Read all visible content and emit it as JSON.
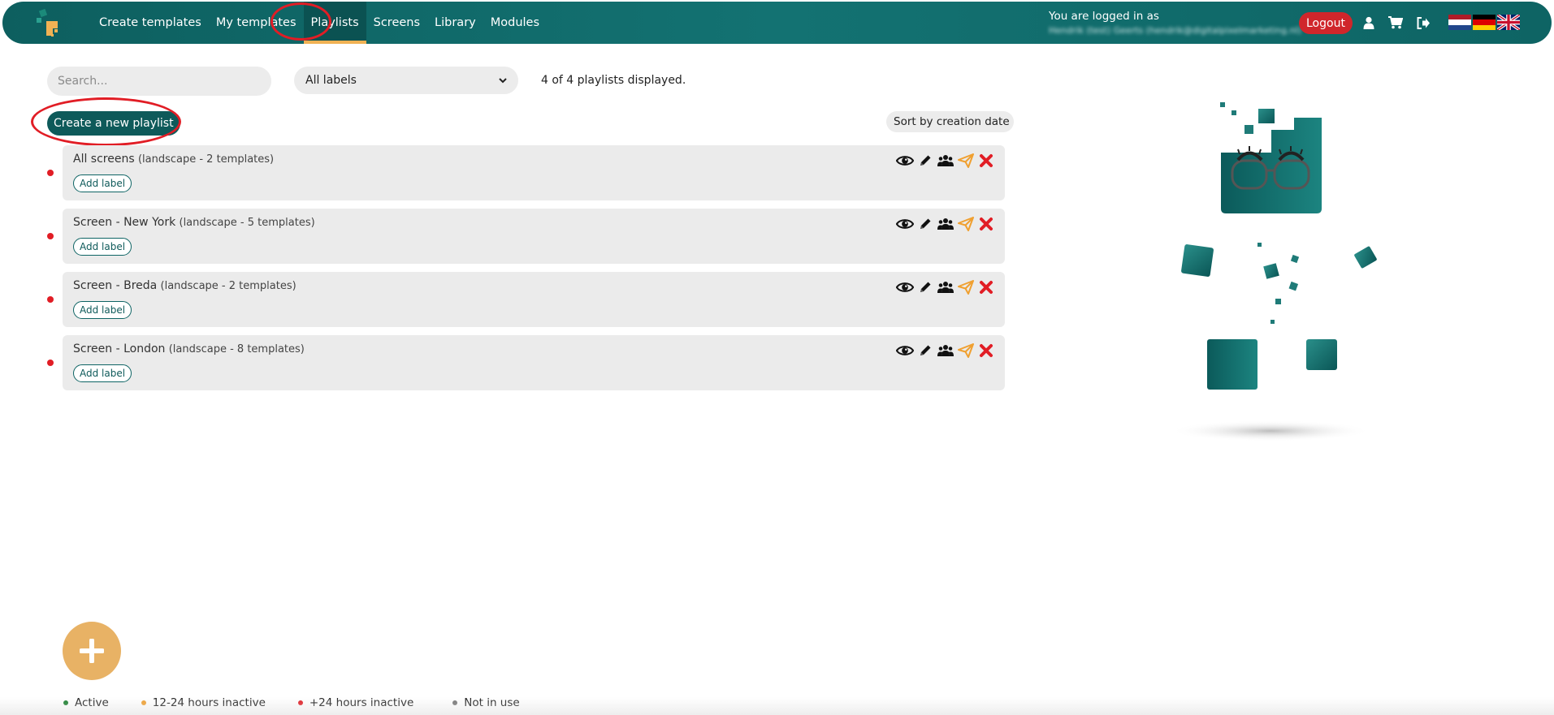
{
  "nav": {
    "links": [
      {
        "label": "Create templates"
      },
      {
        "label": "My templates"
      },
      {
        "label": "Playlists"
      },
      {
        "label": "Screens"
      },
      {
        "label": "Library"
      },
      {
        "label": "Modules"
      }
    ],
    "active": "Playlists",
    "login_label": "You are logged in as",
    "login_user": "Hendrik (test) Geerts (hendrik@digitalpixelmarketing.nl)",
    "logout_label": "Logout",
    "icons": [
      "user-icon",
      "cart-icon",
      "sign-out-icon"
    ],
    "flags": [
      "nl-flag-icon",
      "de-flag-icon",
      "uk-flag-icon"
    ]
  },
  "toolbar": {
    "search_placeholder": "Search...",
    "label_filter": "All labels",
    "count_text": "4 of 4 playlists displayed.",
    "create_label": "Create a new playlist",
    "sort_label": "Sort by creation date"
  },
  "playlists": [
    {
      "name": "All screens",
      "meta": "(landscape - 2 templates)",
      "add_label": "Add label",
      "status": "+24 hours inactive"
    },
    {
      "name": "Screen -  New York",
      "meta": "(landscape - 5 templates)",
      "add_label": "Add label",
      "status": "+24 hours inactive"
    },
    {
      "name": "Screen -  Breda",
      "meta": "(landscape - 2 templates)",
      "add_label": "Add label",
      "status": "+24 hours inactive"
    },
    {
      "name": "Screen -  London",
      "meta": "(landscape - 8 templates)",
      "add_label": "Add label",
      "status": "+24 hours inactive"
    }
  ],
  "row_actions": [
    "eye-icon",
    "pencil-icon",
    "users-icon",
    "send-icon",
    "delete-icon"
  ],
  "legend": [
    {
      "label": "Active",
      "color": "#1a7f2e"
    },
    {
      "label": "12-24 hours inactive",
      "color": "#f0a030"
    },
    {
      "label": "+24 hours inactive",
      "color": "#e11d25"
    },
    {
      "label": "Not in use",
      "color": "#777777"
    }
  ],
  "colors": {
    "brand": "#0e6464",
    "accent": "#f0b254",
    "danger": "#e11d25"
  }
}
